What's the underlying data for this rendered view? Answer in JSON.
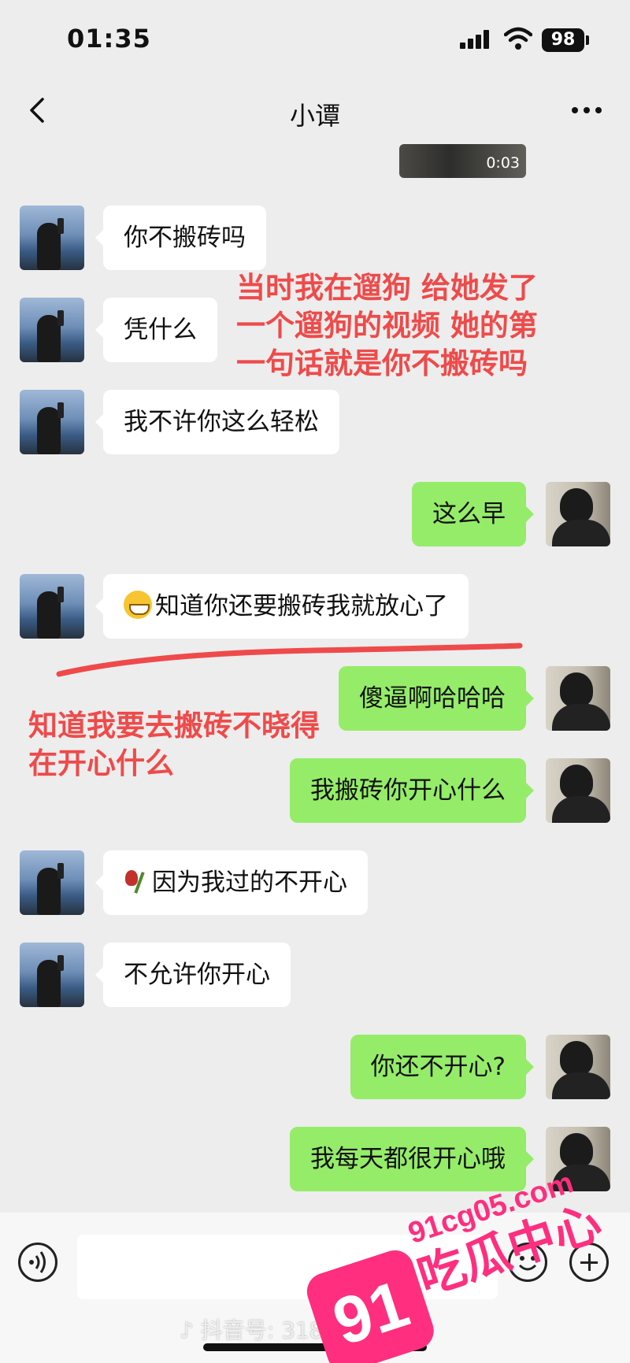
{
  "status_bar": {
    "time": "01:35",
    "battery": "98"
  },
  "nav": {
    "title": "小谭"
  },
  "video": {
    "duration": "0:03"
  },
  "messages": [
    {
      "side": "her",
      "text": "你不搬砖吗"
    },
    {
      "side": "her",
      "text": "凭什么"
    },
    {
      "side": "her",
      "text": "我不许你这么轻松"
    },
    {
      "side": "me",
      "text": "这么早"
    },
    {
      "side": "her",
      "emoji": "grin",
      "text": "知道你还要搬砖我就放心了"
    },
    {
      "side": "me",
      "text": "傻逼啊哈哈哈"
    },
    {
      "side": "me",
      "text": "我搬砖你开心什么"
    },
    {
      "side": "her",
      "emoji": "wilted-rose",
      "text": "因为我过的不开心"
    },
    {
      "side": "her",
      "text": "不允许你开心"
    },
    {
      "side": "me",
      "text": "你还不开心?"
    },
    {
      "side": "me",
      "text": "我每天都很开心哦"
    }
  ],
  "annotations": {
    "first": [
      "当时我在遛狗 给她发了",
      "一个遛狗的视频 她的第",
      "一句话就是你不搬砖吗"
    ],
    "second": [
      "知道我要去搬砖不晓得",
      "在开心什么"
    ]
  },
  "footer": {
    "douyin_id": "抖音号: 318   87"
  },
  "watermark": {
    "logo": "91",
    "site": "91cg05.com",
    "name": "吃瓜中心"
  },
  "colors": {
    "my_bubble": "#95ec69",
    "her_bubble": "#ffffff",
    "annotation": "#ef4a4a",
    "watermark": "#ff2e7e"
  },
  "icons": [
    "back-icon",
    "more-icon",
    "voice-icon",
    "emoji-icon",
    "plus-icon",
    "signal-icon",
    "wifi-icon",
    "battery-icon",
    "douyin-icon"
  ]
}
